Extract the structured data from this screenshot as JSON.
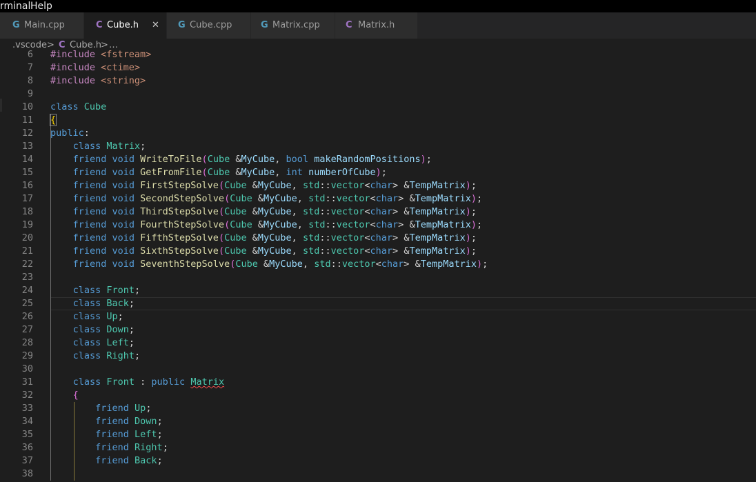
{
  "menubar": {
    "items": [
      "rminal",
      "Help"
    ]
  },
  "tabs": [
    {
      "label": "Main.cpp",
      "icon": "cpp",
      "active": false
    },
    {
      "label": "Cube.h",
      "icon": "h",
      "active": true,
      "close": "✕"
    },
    {
      "label": "Cube.cpp",
      "icon": "cpp",
      "active": false
    },
    {
      "label": "Matrix.cpp",
      "icon": "cpp",
      "active": false
    },
    {
      "label": "Matrix.h",
      "icon": "h",
      "active": false
    }
  ],
  "icons": {
    "cpp": "G",
    "h": "C"
  },
  "breadcrumb": {
    "folder": ".vscode",
    "sep": ">",
    "file_icon": "C",
    "file": "Cube.h",
    "tail": "…"
  },
  "editor": {
    "first_line_number": 6,
    "lines": [
      {
        "n": "6",
        "text": "#include <fstream>"
      },
      {
        "n": "7",
        "text": "#include <ctime>"
      },
      {
        "n": "8",
        "text": "#include <string>"
      },
      {
        "n": "9",
        "text": ""
      },
      {
        "n": "10",
        "text": "class Cube"
      },
      {
        "n": "11",
        "text": "{"
      },
      {
        "n": "12",
        "text": "public:"
      },
      {
        "n": "13",
        "text": "    class Matrix;"
      },
      {
        "n": "14",
        "text": "    friend void WriteToFile(Cube &MyCube, bool makeRandomPositions);"
      },
      {
        "n": "15",
        "text": "    friend void GetFromFile(Cube &MyCube, int numberOfCube);"
      },
      {
        "n": "16",
        "text": "    friend void FirstStepSolve(Cube &MyCube, std::vector<char> &TempMatrix);"
      },
      {
        "n": "17",
        "text": "    friend void SecondStepSolve(Cube &MyCube, std::vector<char> &TempMatrix);"
      },
      {
        "n": "18",
        "text": "    friend void ThirdStepSolve(Cube &MyCube, std::vector<char> &TempMatrix);"
      },
      {
        "n": "19",
        "text": "    friend void FourthStepSolve(Cube &MyCube, std::vector<char> &TempMatrix);"
      },
      {
        "n": "20",
        "text": "    friend void FifthStepSolve(Cube &MyCube, std::vector<char> &TempMatrix);"
      },
      {
        "n": "21",
        "text": "    friend void SixthStepSolve(Cube &MyCube, std::vector<char> &TempMatrix);"
      },
      {
        "n": "22",
        "text": "    friend void SeventhStepSolve(Cube &MyCube, std::vector<char> &TempMatrix);"
      },
      {
        "n": "23",
        "text": ""
      },
      {
        "n": "24",
        "text": "    class Front;"
      },
      {
        "n": "25",
        "text": "    class Back;"
      },
      {
        "n": "26",
        "text": "    class Up;"
      },
      {
        "n": "27",
        "text": "    class Down;"
      },
      {
        "n": "28",
        "text": "    class Left;"
      },
      {
        "n": "29",
        "text": "    class Right;"
      },
      {
        "n": "30",
        "text": ""
      },
      {
        "n": "31",
        "text": "    class Front : public Matrix"
      },
      {
        "n": "32",
        "text": "    {"
      },
      {
        "n": "33",
        "text": "        friend Up;"
      },
      {
        "n": "34",
        "text": "        friend Down;"
      },
      {
        "n": "35",
        "text": "        friend Left;"
      },
      {
        "n": "36",
        "text": "        friend Right;"
      },
      {
        "n": "37",
        "text": "        friend Back;"
      },
      {
        "n": "38",
        "text": ""
      }
    ],
    "cursor_line": "25",
    "error_word": "Matrix"
  }
}
